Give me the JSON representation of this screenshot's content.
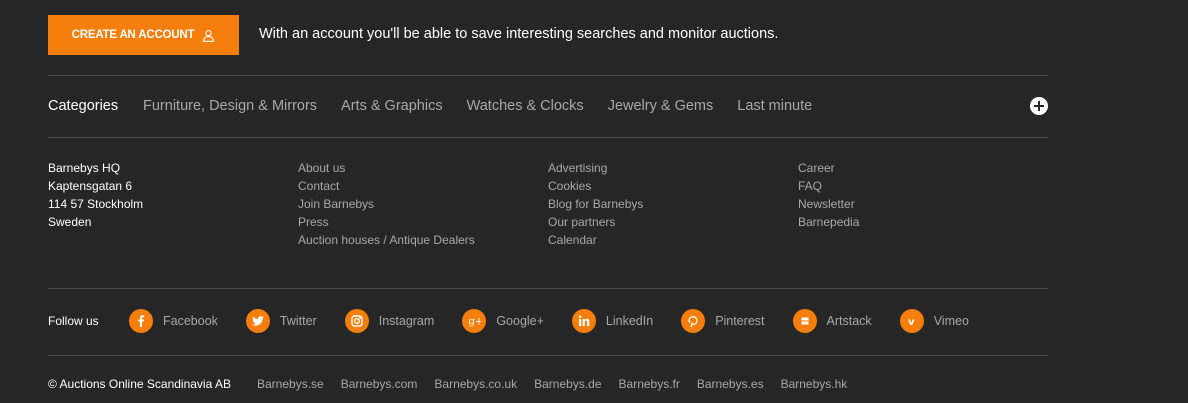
{
  "cta": {
    "button_label": "Create an account",
    "description": "With an account you'll be able to save interesting searches and monitor auctions."
  },
  "categories": {
    "title": "Categories",
    "items": [
      "Furniture, Design & Mirrors",
      "Arts & Graphics",
      "Watches & Clocks",
      "Jewelry & Gems",
      "Last minute"
    ],
    "expand_icon": "plus-circle-icon"
  },
  "address": [
    "Barnebys HQ",
    "Kaptensgatan 6",
    "114 57 Stockholm",
    "Sweden"
  ],
  "links": {
    "col1": [
      "About us",
      "Contact",
      "Join Barnebys",
      "Press",
      "Auction houses / Antique Dealers"
    ],
    "col2": [
      "Advertising",
      "Cookies",
      "Blog for Barnebys",
      "Our partners",
      "Calendar"
    ],
    "col3": [
      "Career",
      "FAQ",
      "Newsletter",
      "Barnepedia"
    ]
  },
  "social": {
    "label": "Follow us",
    "items": [
      {
        "label": "Facebook",
        "icon": "facebook-icon"
      },
      {
        "label": "Twitter",
        "icon": "twitter-icon"
      },
      {
        "label": "Instagram",
        "icon": "instagram-icon"
      },
      {
        "label": "Google+",
        "icon": "google-plus-icon"
      },
      {
        "label": "LinkedIn",
        "icon": "linkedin-icon"
      },
      {
        "label": "Pinterest",
        "icon": "pinterest-icon"
      },
      {
        "label": "Artstack",
        "icon": "artstack-icon"
      },
      {
        "label": "Vimeo",
        "icon": "vimeo-icon"
      }
    ]
  },
  "bottom": {
    "copyright": "© Auctions Online Scandinavia AB",
    "sites": [
      "Barnebys.se",
      "Barnebys.com",
      "Barnebys.co.uk",
      "Barnebys.de",
      "Barnebys.fr",
      "Barnebys.es",
      "Barnebys.hk"
    ]
  },
  "colors": {
    "accent": "#f57e0d",
    "background": "#262626",
    "muted_text": "#a8a8a8",
    "rule": "#4a4a4a"
  }
}
